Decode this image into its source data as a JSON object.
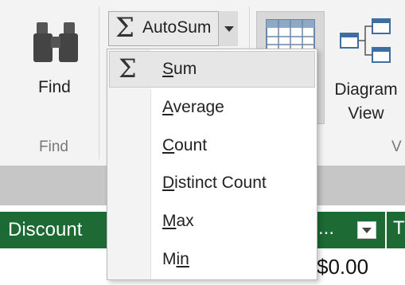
{
  "ribbon": {
    "find": {
      "label": "Find",
      "group_label": "Find",
      "icon": "binoculars-icon"
    },
    "autosum": {
      "label": "AutoSum",
      "icon": "sigma-icon"
    },
    "grid": {
      "icon": "table-grid-icon"
    },
    "diagram": {
      "label_line1": "Diagram",
      "label_line2": "View",
      "icon": "diagram-view-icon"
    },
    "right_group_label": "V"
  },
  "menu": {
    "items": [
      {
        "label_first": "S",
        "label_rest": "um",
        "highlighted": true,
        "icon": "sigma-icon"
      },
      {
        "label_first": "A",
        "label_rest": "verage"
      },
      {
        "label_first": "C",
        "label_rest": "ount"
      },
      {
        "label_first": "D",
        "label_rest": "istinct Count"
      },
      {
        "label_first": "M",
        "label_rest": "ax"
      },
      {
        "label_first": "M",
        "label_rest": "in",
        "underline_index": 1
      }
    ]
  },
  "grid": {
    "header_left": "Discount",
    "header_mid": "...",
    "header_right": "T",
    "value": "$0.00"
  },
  "colors": {
    "ribbon_bg": "#f3f3f3",
    "header_green": "#1d6a35",
    "band_gray": "#c6c6c6"
  }
}
